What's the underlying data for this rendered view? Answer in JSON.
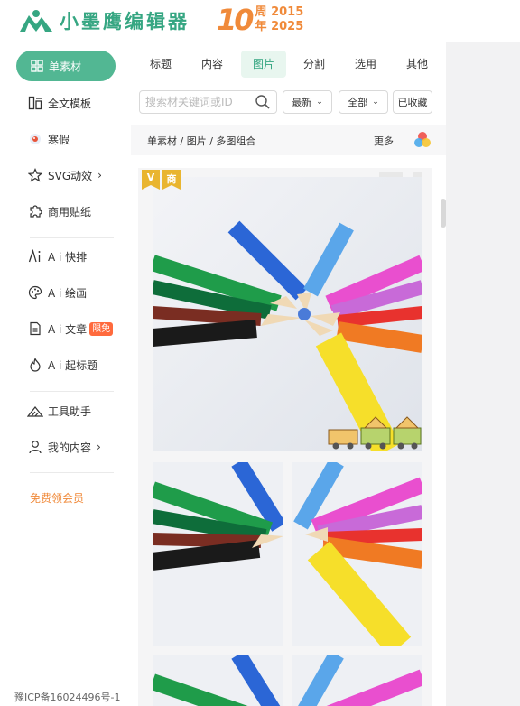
{
  "brand": {
    "name": "小墨鹰编辑器",
    "anniversary_number": "10",
    "anniversary_word_1": "周",
    "anniversary_year_1": "2015",
    "anniversary_word_2": "年",
    "anniversary_year_2": "2025",
    "color": "#36a682",
    "accent": "#f08a3a"
  },
  "sidebar": {
    "active": {
      "label": "单素材",
      "icon": "grid-icon"
    },
    "items": [
      {
        "label": "全文模板",
        "icon": "template-icon"
      },
      {
        "label": "寒假",
        "icon": "holiday-icon"
      },
      {
        "label": "SVG动效",
        "icon": "star-icon",
        "chevron": "›"
      },
      {
        "label": "商用贴纸",
        "icon": "puzzle-icon"
      },
      {
        "label": "A i 快排",
        "icon": "ai-icon"
      },
      {
        "label": "A i 绘画",
        "icon": "palette-icon"
      },
      {
        "label": "A i 文章",
        "icon": "doc-icon",
        "badge": "限免"
      },
      {
        "label": "A i 起标题",
        "icon": "flame-icon"
      },
      {
        "label": "工具助手",
        "icon": "tools-icon"
      },
      {
        "label": "我的内容",
        "icon": "user-icon",
        "chevron": "›"
      }
    ],
    "vip_link": "免费领会员",
    "icp": "豫ICP备16024496号-1"
  },
  "tabs": [
    "标题",
    "内容",
    "图片",
    "分割",
    "选用",
    "其他"
  ],
  "active_tab": "图片",
  "search": {
    "placeholder": "搜索材关键词或ID"
  },
  "filters": {
    "sort": "最新",
    "scope": "全部",
    "favorites": "已收藏"
  },
  "breadcrumb": "单素材 / 图片 / 多图组合",
  "more_label": "更多",
  "tags": {
    "vip": "V",
    "commercial": "商"
  }
}
